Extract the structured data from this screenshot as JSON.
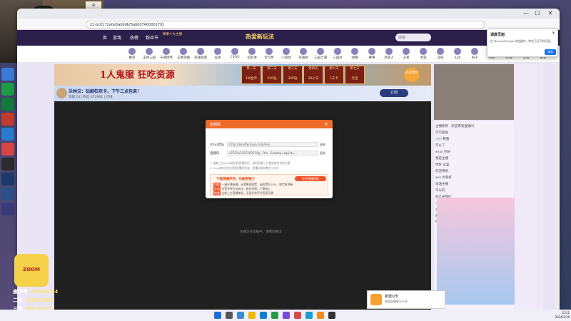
{
  "webcam": {
    "sign_text": "冲"
  },
  "browser": {
    "address": "21-bc0172a0e5ab9dbf3a6d07400001701",
    "win_min": "—",
    "win_max": "☐",
    "win_close": "✕"
  },
  "site": {
    "nav_items": [
      "首",
      "游戏",
      "热榜",
      "粉丝节"
    ],
    "nav_badge": "赛事十大主播",
    "nav_center": "热爱新玩法",
    "search_placeholder": "搜索"
  },
  "categories": [
    "推荐",
    "王牌三国",
    "千禧情怀",
    "王者荣耀",
    "英雄联盟",
    "美团",
    "CSGO",
    "羽毛球",
    "宝可梦",
    "小游戏",
    "英雄杀",
    "三国之潮",
    "三国杀",
    "弹幕",
    "赛事",
    "风景人",
    "王者",
    "手游",
    "竞技",
    "火凤",
    "兔子",
    "闪光",
    "礼物",
    "无畏",
    "更多"
  ],
  "banner": {
    "title": "1人鬼服 狂吃资源",
    "rewards": [
      "第一天",
      "第二天",
      "第三天",
      "第四天",
      "第六天",
      "第七天"
    ],
    "reward_items": [
      "1W金币",
      "500钻",
      "300钻",
      "30小马",
      "1天卡",
      "元宝"
    ],
    "cta": "开启梦幻"
  },
  "room": {
    "title": "兰林汉：钻剧狂欢卡，下午三点包来！",
    "meta": "等级 13 | 粉丝 472961 | 在线",
    "follow": "订阅"
  },
  "loading_text": "主播正在加载中，请稍后重试",
  "modal": {
    "title": "复制码",
    "close": "×",
    "rows": [
      {
        "label": "rtmp地址",
        "value": "rtmp://sendfw.huya.com/live",
        "copy": "复制"
      },
      {
        "label": "直播码",
        "value": "47525x3397202519g...?fm...&dxzbp=zq&ct=...",
        "copy": "复制"
      }
    ],
    "notes": [
      "1. 复制上方rtmp地址和直播码后，粘贴到第三方推流软件对应位置",
      "2. rtmp地址仅在切换直播时失效，直播码有效期为7小时"
    ],
    "box_title": "千度直播伴侣，功能更强大",
    "box_btn": "打开直播伴侣",
    "box_rows": [
      {
        "tag": "功能",
        "text": "一键开播直播，无需繁琐配置，画质提升20%，稳定更流畅"
      },
      {
        "tag": "互动",
        "text": "内置多种互动玩法，粉丝秒懂，主播省心"
      },
      {
        "tag": "快速",
        "text": "全新三方直播体验，无需多余环节直接开播"
      }
    ]
  },
  "edge_popup": {
    "title": "调度页面",
    "text": "在 Microsoft Edge 浏览器中，你有已打开的页面。",
    "button": "浏览",
    "close": "✕"
  },
  "overlay": {
    "logo": "ZOOM",
    "lines": [
      {
        "label": "扇中号",
        "num": "444060254"
      },
      {
        "label": "二群",
        "num": "915215862"
      },
      {
        "label": "三群",
        "num": "604343252"
      }
    ]
  },
  "download": {
    "title": "新建Q市",
    "sub": "智能直播聊天分享"
  },
  "chat": [
    "主播昵称 · 欢迎来到直播间",
    "可可爱爱",
    "小小 看看",
    "可以了",
    "xxxx 你好",
    "我是主播",
    "你好 这里",
    "欢迎来到",
    "xxx 大家好",
    "加油主播",
    "可以的",
    "前几天我们",
    "小明 来了",
    "主播好厉害",
    "哈哈哈哈",
    "666"
  ],
  "clock": {
    "time": "15:51",
    "date": "2024/1/16"
  },
  "colors": {
    "accent": "#ee6b2a",
    "nav": "#2b1f4b",
    "overlay_num": "#ffe66b"
  }
}
